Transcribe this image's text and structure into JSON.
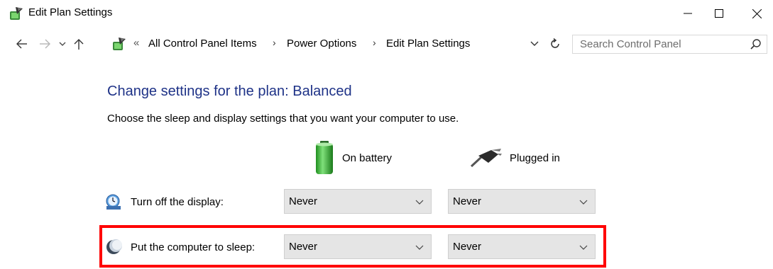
{
  "window": {
    "title": "Edit Plan Settings",
    "icon": "power-plan-icon"
  },
  "nav": {
    "breadcrumbs": [
      "All Control Panel Items",
      "Power Options",
      "Edit Plan Settings"
    ],
    "overflow": "«",
    "separator": "›"
  },
  "search": {
    "placeholder": "Search Control Panel"
  },
  "main": {
    "title": "Change settings for the plan: Balanced",
    "description": "Choose the sleep and display settings that you want your computer to use.",
    "columns": {
      "battery": {
        "label": "On battery",
        "icon": "battery-icon"
      },
      "plugged": {
        "label": "Plugged in",
        "icon": "power-plug-icon"
      }
    },
    "settings": [
      {
        "label": "Turn off the display:",
        "icon": "display-clock-icon",
        "on_battery": "Never",
        "plugged_in": "Never"
      },
      {
        "label": "Put the computer to sleep:",
        "icon": "moon-sleep-icon",
        "on_battery": "Never",
        "plugged_in": "Never",
        "highlighted": true
      }
    ]
  },
  "colors": {
    "title_blue": "#1e3287",
    "highlight_red": "#ff0000",
    "dropdown_bg": "#e5e5e5"
  }
}
